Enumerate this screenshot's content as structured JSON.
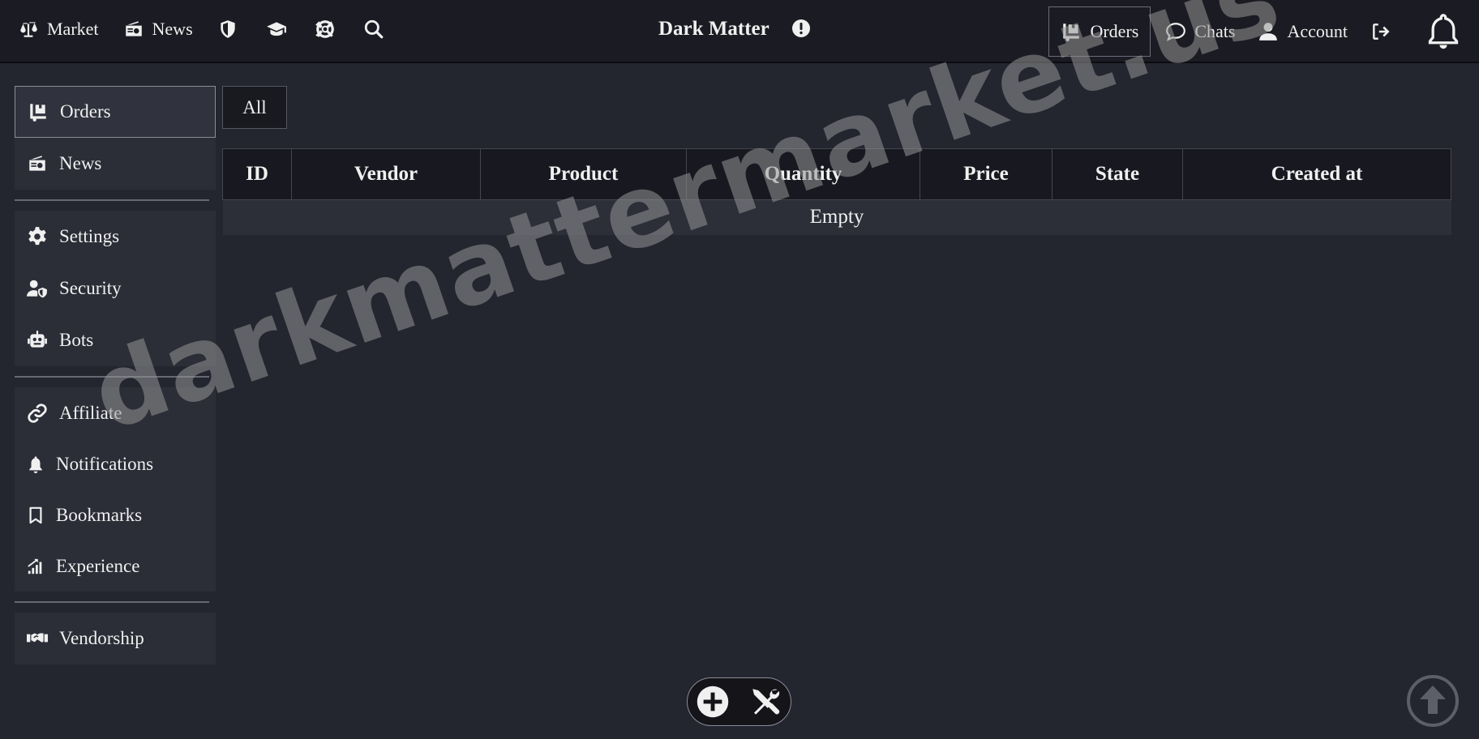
{
  "header": {
    "left_nav": [
      {
        "label": "Market",
        "icon": "scale-icon"
      },
      {
        "label": "News",
        "icon": "radio-icon"
      }
    ],
    "icon_links": [
      "shield-icon",
      "graduation-cap-icon",
      "lifebuoy-icon",
      "search-icon"
    ],
    "brand": "Dark Matter",
    "right_nav": [
      {
        "label": "Orders",
        "icon": "dolly-icon"
      },
      {
        "label": "Chats",
        "icon": "chat-bubble-icon"
      },
      {
        "label": "Account",
        "icon": "user-icon"
      }
    ]
  },
  "sidebar": {
    "group1": [
      {
        "label": "Orders",
        "icon": "dolly-icon"
      },
      {
        "label": "News",
        "icon": "radio-icon"
      }
    ],
    "group2": [
      {
        "label": "Settings",
        "icon": "gear-icon"
      },
      {
        "label": "Security",
        "icon": "user-shield-icon"
      },
      {
        "label": "Bots",
        "icon": "robot-icon"
      }
    ],
    "group3": [
      {
        "label": "Affiliate",
        "icon": "link-icon"
      },
      {
        "label": "Notifications",
        "icon": "bell-icon"
      },
      {
        "label": "Bookmarks",
        "icon": "bookmark-icon"
      },
      {
        "label": "Experience",
        "icon": "chart-icon"
      }
    ],
    "group4": [
      {
        "label": "Vendorship",
        "icon": "handshake-icon"
      }
    ]
  },
  "main": {
    "filter_tab": "All",
    "table": {
      "columns": [
        "ID",
        "Vendor",
        "Product",
        "Quantity",
        "Price",
        "State",
        "Created at"
      ],
      "empty_text": "Empty"
    }
  },
  "watermark": "darkmattermarket.us"
}
